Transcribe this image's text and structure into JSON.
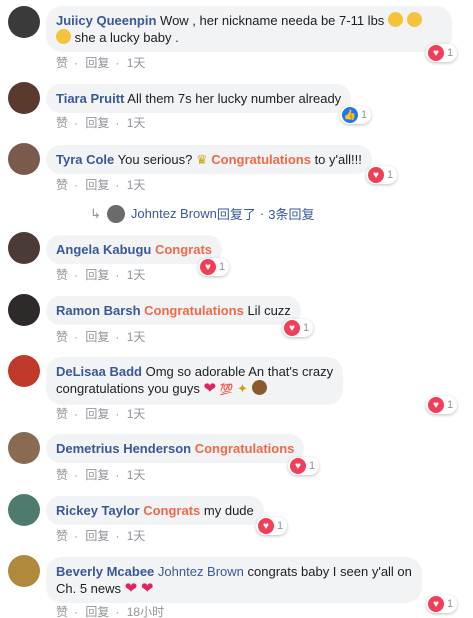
{
  "meta_labels": {
    "like": "赞",
    "reply": "回复"
  },
  "comments": [
    {
      "name": "Juiicy Queenpin",
      "text": "Wow , her nickname needa be 7-11 lbs",
      "text2": "she a lucky baby .",
      "time": "1天",
      "reaction": "love",
      "count": "1",
      "avatar_color": "#3a3a3a"
    },
    {
      "name": "Tiara Pruitt",
      "text": "All them 7s her lucky number already",
      "time": "1天",
      "reaction": "like",
      "count": "1",
      "avatar_color": "#5b3a2e"
    },
    {
      "name": "Tyra Cole",
      "text": "You serious?",
      "highlight": "Congratulations",
      "text_after": "to y'all!!!",
      "time": "1天",
      "reaction": "love",
      "count": "1",
      "avatar_color": "#7a5a4a"
    },
    {
      "name": "Angela Kabugu",
      "highlight": "Congrats",
      "time": "1天",
      "reaction": "love",
      "count": "1",
      "avatar_color": "#4a3b34"
    },
    {
      "name": "Ramon Barsh",
      "highlight": "Congratulations",
      "text_after": "Lil cuzz",
      "time": "1天",
      "reaction": "love",
      "count": "1",
      "avatar_color": "#2f2a2a"
    },
    {
      "name": "DeLisaa Badd",
      "text": "Omg so adorable An that's crazy",
      "text2": "congratulations you guys",
      "time": "1天",
      "reaction": "love",
      "count": "1",
      "avatar_color": "#c0392b"
    },
    {
      "name": "Demetrius Henderson",
      "highlight": "Congratulations",
      "time": "1天",
      "reaction": "love",
      "count": "1",
      "avatar_color": "#8a6a52"
    },
    {
      "name": "Rickey Taylor",
      "highlight": "Congrats",
      "text_after": "my dude",
      "time": "1天",
      "reaction": "love",
      "count": "1",
      "avatar_color": "#4f7b6e"
    },
    {
      "name": "Beverly Mcabee",
      "mention": "Johntez Brown",
      "text": "congrats baby I seen y'all on",
      "text2": "Ch. 5 news",
      "time": "18小时",
      "reaction": "love",
      "count": "1",
      "avatar_color": "#b08a3a"
    }
  ],
  "reply_thread": {
    "name": "Johntez Brown",
    "label": "回复了",
    "sep": "·",
    "count_label": "3条回复"
  }
}
